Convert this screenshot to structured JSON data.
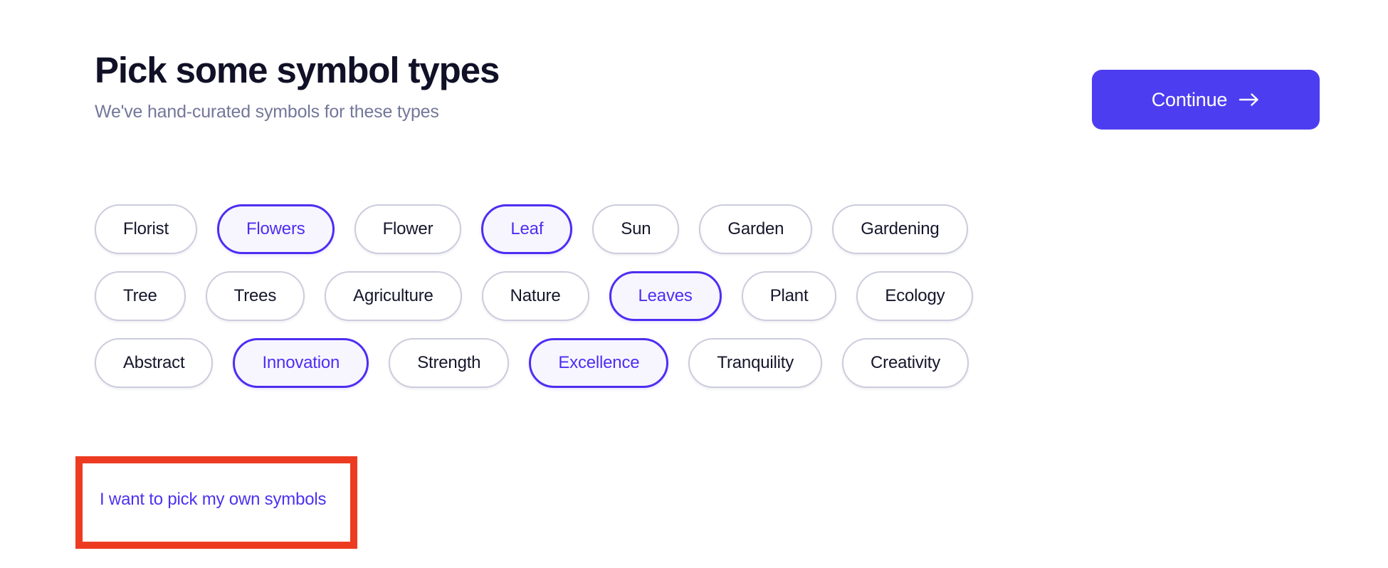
{
  "header": {
    "title": "Pick some symbol types",
    "subtitle": "We've hand-curated symbols for these types",
    "continue_label": "Continue",
    "continue_icon": "arrow-right-icon"
  },
  "chips": {
    "rows": [
      [
        {
          "label": "Florist",
          "selected": false
        },
        {
          "label": "Flowers",
          "selected": true
        },
        {
          "label": "Flower",
          "selected": false
        },
        {
          "label": "Leaf",
          "selected": true
        },
        {
          "label": "Sun",
          "selected": false
        },
        {
          "label": "Garden",
          "selected": false
        },
        {
          "label": "Gardening",
          "selected": false
        }
      ],
      [
        {
          "label": "Tree",
          "selected": false
        },
        {
          "label": "Trees",
          "selected": false
        },
        {
          "label": "Agriculture",
          "selected": false
        },
        {
          "label": "Nature",
          "selected": false
        },
        {
          "label": "Leaves",
          "selected": true
        },
        {
          "label": "Plant",
          "selected": false
        },
        {
          "label": "Ecology",
          "selected": false
        }
      ],
      [
        {
          "label": "Abstract",
          "selected": false
        },
        {
          "label": "Innovation",
          "selected": true
        },
        {
          "label": "Strength",
          "selected": false
        },
        {
          "label": "Excellence",
          "selected": true
        },
        {
          "label": "Tranquility",
          "selected": false
        },
        {
          "label": "Creativity",
          "selected": false
        }
      ]
    ]
  },
  "footer": {
    "own_symbols_link": "I want to pick my own symbols"
  },
  "colors": {
    "accent": "#4d3df0",
    "chip_selected_border": "#4d2ef3",
    "chip_selected_bg": "#f7f6fe",
    "chip_border": "#cbccdd",
    "title": "#101127",
    "subtitle": "#73779a",
    "link": "#4c32f0",
    "annotation": "#ed3b22",
    "background": "#ffffff"
  }
}
